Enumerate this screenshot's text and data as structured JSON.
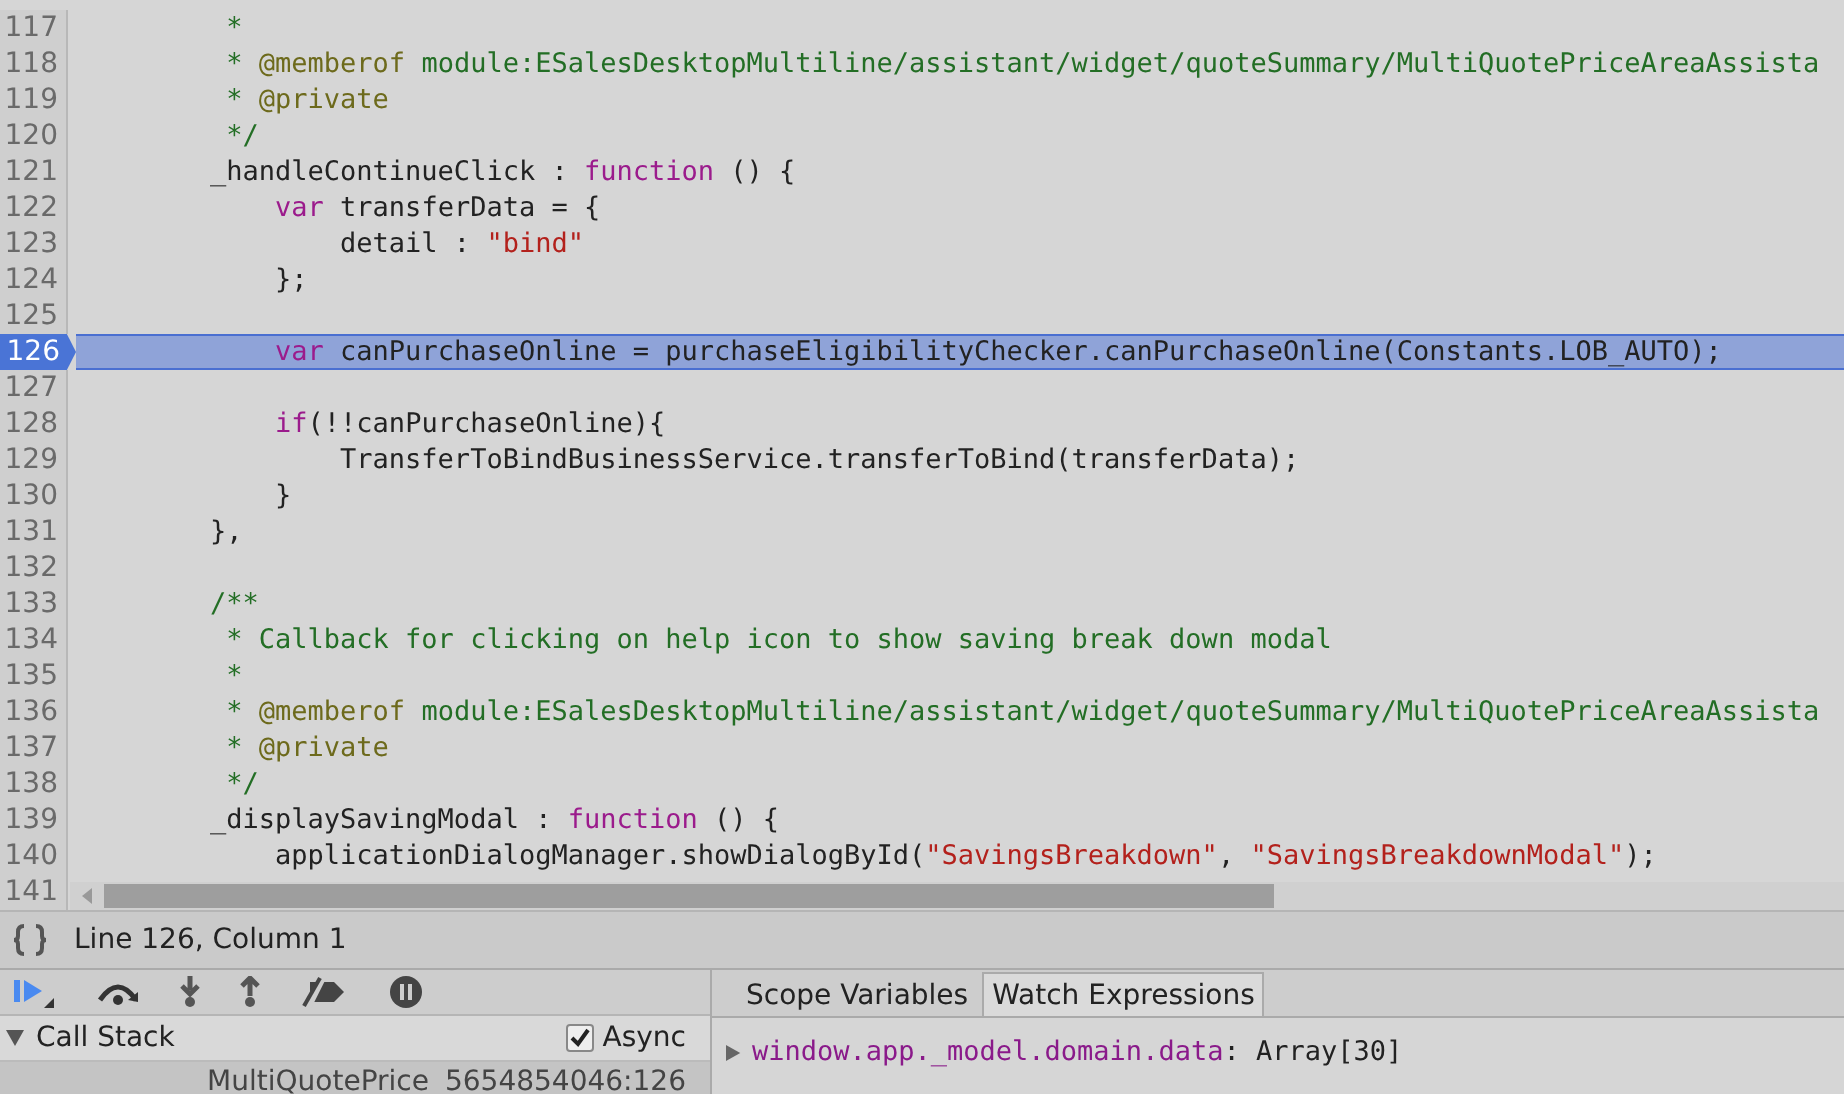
{
  "editor": {
    "lines": [
      {
        "number": "117",
        "current": false,
        "tokens": [
          {
            "kind": "comment",
            "text": "         *"
          }
        ]
      },
      {
        "number": "118",
        "current": false,
        "tokens": [
          {
            "kind": "comment",
            "text": "         * "
          },
          {
            "kind": "doctag",
            "text": "@memberof"
          },
          {
            "kind": "comment",
            "text": " module:ESalesDesktopMultiline/assistant/widget/quoteSummary/MultiQuotePriceAreaAssista"
          }
        ]
      },
      {
        "number": "119",
        "current": false,
        "tokens": [
          {
            "kind": "comment",
            "text": "         * "
          },
          {
            "kind": "doctag",
            "text": "@private"
          }
        ]
      },
      {
        "number": "120",
        "current": false,
        "tokens": [
          {
            "kind": "comment",
            "text": "         */"
          }
        ]
      },
      {
        "number": "121",
        "current": false,
        "tokens": [
          {
            "kind": "plain",
            "text": "        _handleContinueClick : "
          },
          {
            "kind": "keyword",
            "text": "function"
          },
          {
            "kind": "plain",
            "text": " () {"
          }
        ]
      },
      {
        "number": "122",
        "current": false,
        "tokens": [
          {
            "kind": "keyword",
            "text": "            var"
          },
          {
            "kind": "plain",
            "text": " transferData = {"
          }
        ]
      },
      {
        "number": "123",
        "current": false,
        "tokens": [
          {
            "kind": "plain",
            "text": "                detail : "
          },
          {
            "kind": "string",
            "text": "\"bind\""
          }
        ]
      },
      {
        "number": "124",
        "current": false,
        "tokens": [
          {
            "kind": "plain",
            "text": "            };"
          }
        ]
      },
      {
        "number": "125",
        "current": false
      },
      {
        "number": "126",
        "current": true,
        "tokens": [
          {
            "kind": "keyword",
            "text": "            var"
          },
          {
            "kind": "plain",
            "text": " canPurchaseOnline = purchaseEligibilityChecker.canPurchaseOnline(Constants.LOB_AUTO);"
          }
        ]
      },
      {
        "number": "127",
        "current": false
      },
      {
        "number": "128",
        "current": false,
        "tokens": [
          {
            "kind": "keyword",
            "text": "            if"
          },
          {
            "kind": "plain",
            "text": "(!!canPurchaseOnline){"
          }
        ]
      },
      {
        "number": "129",
        "current": false,
        "tokens": [
          {
            "kind": "plain",
            "text": "                TransferToBindBusinessService.transferToBind(transferData);"
          }
        ]
      },
      {
        "number": "130",
        "current": false,
        "tokens": [
          {
            "kind": "plain",
            "text": "            }"
          }
        ]
      },
      {
        "number": "131",
        "current": false,
        "tokens": [
          {
            "kind": "plain",
            "text": "        },"
          }
        ]
      },
      {
        "number": "132",
        "current": false
      },
      {
        "number": "133",
        "current": false,
        "tokens": [
          {
            "kind": "comment",
            "text": "        /**"
          }
        ]
      },
      {
        "number": "134",
        "current": false,
        "tokens": [
          {
            "kind": "comment",
            "text": "         * Callback for clicking on help icon to show saving break down modal"
          }
        ]
      },
      {
        "number": "135",
        "current": false,
        "tokens": [
          {
            "kind": "comment",
            "text": "         *"
          }
        ]
      },
      {
        "number": "136",
        "current": false,
        "tokens": [
          {
            "kind": "comment",
            "text": "         * "
          },
          {
            "kind": "doctag",
            "text": "@memberof"
          },
          {
            "kind": "comment",
            "text": " module:ESalesDesktopMultiline/assistant/widget/quoteSummary/MultiQuotePriceAreaAssista"
          }
        ]
      },
      {
        "number": "137",
        "current": false,
        "tokens": [
          {
            "kind": "comment",
            "text": "         * "
          },
          {
            "kind": "doctag",
            "text": "@private"
          }
        ]
      },
      {
        "number": "138",
        "current": false,
        "tokens": [
          {
            "kind": "comment",
            "text": "         */"
          }
        ]
      },
      {
        "number": "139",
        "current": false,
        "tokens": [
          {
            "kind": "plain",
            "text": "        _displaySavingModal : "
          },
          {
            "kind": "keyword",
            "text": "function"
          },
          {
            "kind": "plain",
            "text": " () {"
          }
        ]
      },
      {
        "number": "140",
        "current": false,
        "tokens": [
          {
            "kind": "plain",
            "text": "            applicationDialogManager.showDialogById("
          },
          {
            "kind": "string",
            "text": "\"SavingsBreakdown\""
          },
          {
            "kind": "plain",
            "text": ", "
          },
          {
            "kind": "string",
            "text": "\"SavingsBreakdownModal\""
          },
          {
            "kind": "plain",
            "text": ");"
          }
        ]
      },
      {
        "number": "141",
        "current": false
      }
    ]
  },
  "status_bar": {
    "position": "Line 126, Column 1"
  },
  "call_stack": {
    "title": "Call Stack",
    "expanded": true,
    "async_label": "Async",
    "async_checked": true,
    "frames": [
      {
        "function": "MultiQuotePrice",
        "location": "5654854046:126",
        "selected": true
      }
    ]
  },
  "sidebar_tabs": [
    {
      "label": "Scope Variables",
      "selected": false
    },
    {
      "label": "Watch Expressions",
      "selected": true
    }
  ],
  "watch": [
    {
      "expression": "window.app._model.domain.data",
      "value": ": Array[30]",
      "expanded": false
    }
  ]
}
